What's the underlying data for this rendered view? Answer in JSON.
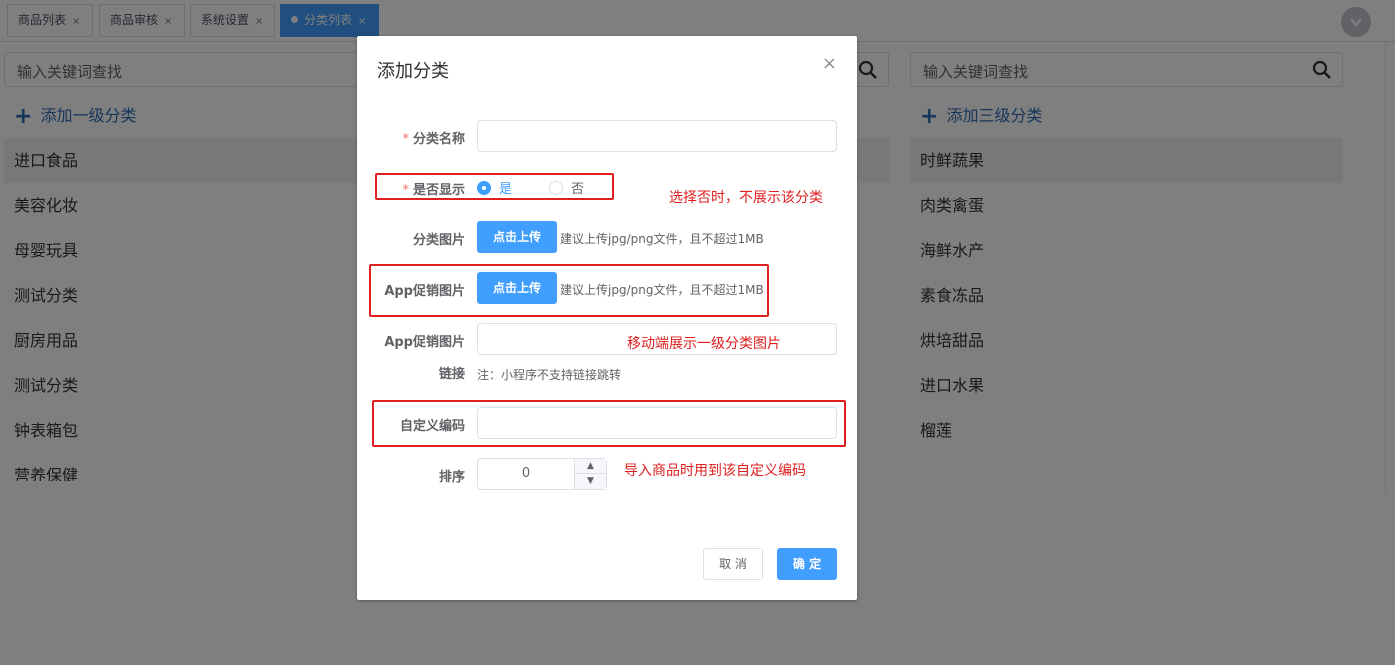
{
  "tabs": [
    {
      "label": "商品列表",
      "close": "×",
      "active": false
    },
    {
      "label": "商品审核",
      "close": "×",
      "active": false
    },
    {
      "label": "系统设置",
      "close": "×",
      "active": false
    },
    {
      "label": "分类列表",
      "close": "×",
      "active": true
    }
  ],
  "left_panel": {
    "search_placeholder": "输入关键词查找",
    "add_label": "添加一级分类",
    "items": [
      "进口食品",
      "美容化妆",
      "母婴玩具",
      "测试分类",
      "厨房用品",
      "测试分类",
      "钟表箱包",
      "营养保健"
    ]
  },
  "right_panel": {
    "search_placeholder": "输入关键词查找",
    "add_label": "添加三级分类",
    "items": [
      "时鲜蔬果",
      "肉类禽蛋",
      "海鲜水产",
      "素食冻品",
      "烘培甜品",
      "进口水果",
      "榴莲"
    ]
  },
  "dialog": {
    "title": "添加分类",
    "close": "×",
    "fields": {
      "name_label": "分类名称",
      "name_value": "",
      "show_label": "是否显示",
      "show_yes": "是",
      "show_no": "否",
      "image_label": "分类图片",
      "upload_label": "点击上传",
      "upload_hint": "建议上传jpg/png文件，且不超过1MB",
      "app_image_label": "App促销图片",
      "app_upload_label": "点击上传",
      "app_upload_hint": "建议上传jpg/png文件，且不超过1MB",
      "app_link_label_1": "App促销图片",
      "app_link_label_2": "链接",
      "app_link_value": "",
      "app_link_note": "注：小程序不支持链接跳转",
      "code_label": "自定义编码",
      "code_value": "",
      "sort_label": "排序",
      "sort_value": "0"
    },
    "cancel": "取 消",
    "confirm": "确 定"
  },
  "annotations": {
    "show_note": "选择否时，不展示该分类",
    "app_image_note": "移动端展示一级分类图片",
    "code_note": "导入商品时用到该自定义编码"
  },
  "colors": {
    "accent": "#409eff",
    "annotation": "#e02020",
    "required": "#f56c6c",
    "link": "#2d6cb5"
  }
}
